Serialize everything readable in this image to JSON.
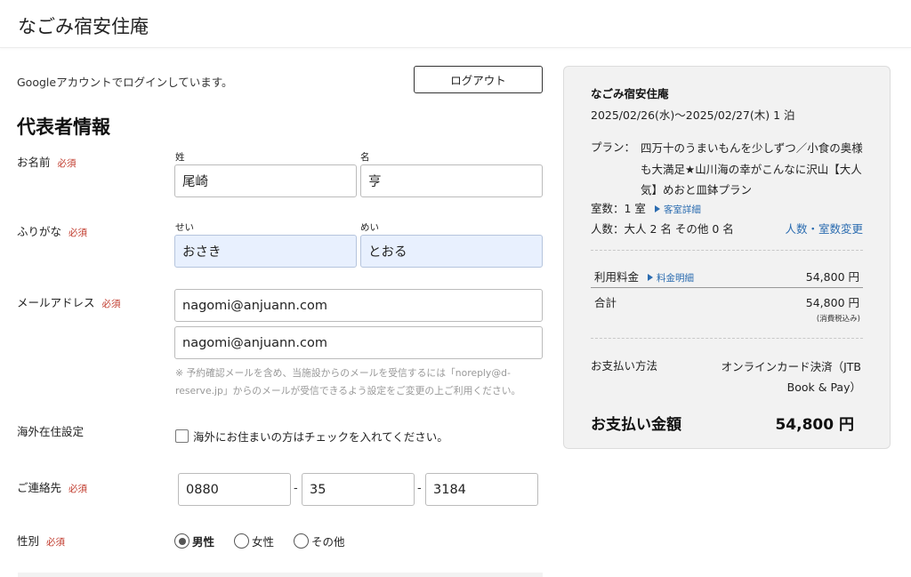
{
  "header": {
    "site_title": "なごみ宿安住庵"
  },
  "account": {
    "login_text": "Googleアカウントでログインしています。",
    "logout_label": "ログアウト"
  },
  "form": {
    "section_title": "代表者情報",
    "required_label": "必須",
    "name": {
      "label": "お名前",
      "last_label": "姓",
      "first_label": "名",
      "last_value": "尾崎",
      "first_value": "亨"
    },
    "kana": {
      "label": "ふりがな",
      "last_label": "せい",
      "first_label": "めい",
      "last_value": "おさき",
      "first_value": "とおる"
    },
    "email": {
      "label": "メールアドレス",
      "value": "nagomi@anjuann.com",
      "confirm_value": "nagomi@anjuann.com",
      "note": "※ 予約確認メールを含め、当施設からのメールを受信するには「noreply@d-reserve.jp」からのメールが受信できるよう設定をご変更の上ご利用ください。"
    },
    "overseas": {
      "label": "海外在住設定",
      "checkbox_label": "海外にお住まいの方はチェックを入れてください。",
      "checked": false
    },
    "phone": {
      "label": "ご連絡先",
      "part1": "0880",
      "part2": "35",
      "part3": "3184",
      "separator": "-"
    },
    "gender": {
      "label": "性別",
      "options": [
        {
          "label": "男性",
          "selected": true
        },
        {
          "label": "女性",
          "selected": false
        },
        {
          "label": "その他",
          "selected": false
        }
      ]
    }
  },
  "summary": {
    "hotel_name": "なごみ宿安住庵",
    "dates": "2025/02/26(水)〜2025/02/27(木) 1 泊",
    "plan_label": "プラン：",
    "plan_text": "四万十のうまいもんを少しずつ／小食の奥様も大満足★山川海の幸がこんなに沢山【大人気】めおと皿鉢プラン",
    "rooms": "室数：1 室",
    "room_detail_link": "客室詳細",
    "people": "人数：大人 2 名 その他 0 名",
    "change_link": "人数・室数変更",
    "fee_label": "利用料金",
    "fee_detail_link": "料金明細",
    "fee_value": "54,800 円",
    "total_label": "合計",
    "total_value": "54,800 円",
    "tax_note": "(消費税込み)",
    "payment_label": "お支払い方法",
    "payment_value": "オンラインカード決済（JTB Book & Pay）",
    "amount_label": "お支払い金額",
    "amount_value": "54,800 円"
  },
  "colors": {
    "required": "#c0392b",
    "link": "#2b6cb0",
    "autofill": "#e8f0fe",
    "panel": "#f2f2f2"
  }
}
